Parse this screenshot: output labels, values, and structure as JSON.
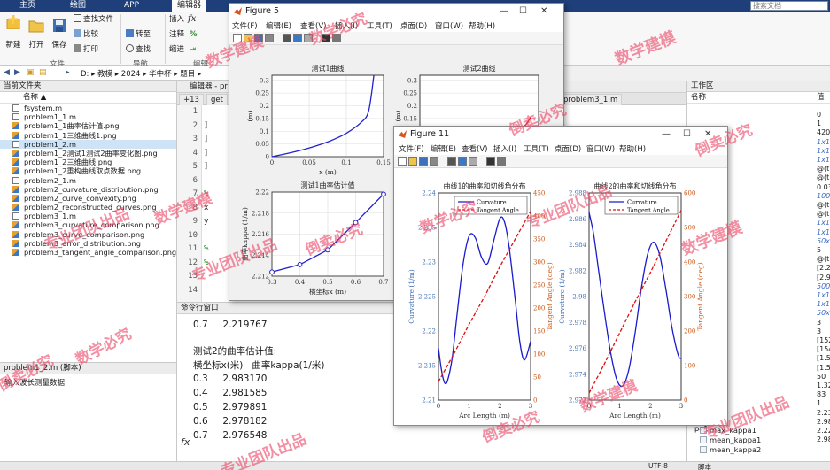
{
  "ribbon": {
    "tabs": [
      "主页",
      "绘图",
      "APP",
      "编辑器"
    ],
    "search_placeholder": "搜索文档",
    "buttons": {
      "new": "新建",
      "open": "打开",
      "save": "保存",
      "find_files": "查找文件",
      "compare": "比较",
      "print": "打印",
      "go_to": "转至",
      "find": "查找",
      "insert": "插入",
      "comment": "注释",
      "indent": "缩进"
    },
    "groups": {
      "file": "文件",
      "navigate": "导航",
      "edit": "编辑"
    }
  },
  "address": {
    "path": [
      "D:",
      "教模",
      "2024",
      "华中杯",
      "题目"
    ]
  },
  "current_folder": {
    "title": "当前文件夹",
    "column": "名称",
    "sort_indicator": "▲",
    "files": [
      {
        "name": "fsystem.m",
        "type": "m"
      },
      {
        "name": "problem1_1.m",
        "type": "m"
      },
      {
        "name": "problem1_1曲率估计值.png",
        "type": "png"
      },
      {
        "name": "problem1_1三维曲线1.png",
        "type": "png"
      },
      {
        "name": "problem1_2.m",
        "type": "m",
        "selected": true
      },
      {
        "name": "problem1_2测试1测试2曲率变化图.png",
        "type": "png"
      },
      {
        "name": "problem1_2三维曲线.png",
        "type": "png"
      },
      {
        "name": "problem1_2重构曲线取点数据.png",
        "type": "png"
      },
      {
        "name": "problem2_1.m",
        "type": "m"
      },
      {
        "name": "problem2_curvature_distribution.png",
        "type": "png"
      },
      {
        "name": "problem2_curve_convexity.png",
        "type": "png"
      },
      {
        "name": "problem2_reconstructed_curves.png",
        "type": "png"
      },
      {
        "name": "problem3_1.m",
        "type": "m"
      },
      {
        "name": "problem3_curvature_comparison.png",
        "type": "png"
      },
      {
        "name": "problem3_curve_comparison.png",
        "type": "png"
      },
      {
        "name": "problem3_error_distribution.png",
        "type": "png"
      },
      {
        "name": "problem3_tangent_angle_comparison.png",
        "type": "png"
      }
    ]
  },
  "details": {
    "title": "problem1_2.m (脚本)",
    "description": "输入波长测量数据"
  },
  "editor": {
    "title": "编辑器 - pr",
    "tabs": [
      "+13",
      "get",
      "problem3_1.m"
    ],
    "line_numbers": [
      "1",
      "2",
      "3",
      "4",
      "5",
      "6",
      "7",
      "8",
      "9",
      "10",
      "11",
      "12",
      "13",
      "14"
    ],
    "fragments": [
      "]",
      "]",
      "]",
      "]",
      "%",
      "x",
      "y",
      "%",
      "%"
    ]
  },
  "command_window": {
    "title": "命令行窗口",
    "prev_line": {
      "x": "0.7",
      "k": "2.219767"
    },
    "heading": "测试2的曲率估计值:",
    "columns": "横坐标x(米)   曲率kappa(1/米)",
    "rows": [
      {
        "x": "0.3",
        "k": "2.983170"
      },
      {
        "x": "0.4",
        "k": "2.981585"
      },
      {
        "x": "0.5",
        "k": "2.979891"
      },
      {
        "x": "0.6",
        "k": "2.978182"
      },
      {
        "x": "0.7",
        "k": "2.976548"
      }
    ],
    "prompt": "fx"
  },
  "workspace": {
    "title": "工作区",
    "col_name": "名称",
    "col_value": "值",
    "values": [
      {
        "text": "0"
      },
      {
        "text": "1"
      },
      {
        "text": "4200"
      },
      {
        "text": "1x1",
        "italic": true
      },
      {
        "text": "1x1",
        "italic": true
      },
      {
        "text": "1x1",
        "italic": true
      },
      {
        "text": "@(t)"
      },
      {
        "text": "@(t)"
      },
      {
        "text": "0.03"
      },
      {
        "text": "100x",
        "italic": true
      },
      {
        "text": "@(t)"
      },
      {
        "text": "@(t)"
      },
      {
        "text": "1x10",
        "italic": true
      },
      {
        "text": "1x1",
        "italic": true
      },
      {
        "text": "50x",
        "italic": true
      },
      {
        "text": "5"
      },
      {
        "text": "@(t)"
      },
      {
        "text": "[2.2"
      },
      {
        "text": "[2.98"
      },
      {
        "text": "500x",
        "italic": true
      },
      {
        "text": "1x1c",
        "italic": true
      },
      {
        "text": "1x10",
        "italic": true
      },
      {
        "text": "50x",
        "italic": true
      },
      {
        "text": "3"
      },
      {
        "text": "3"
      },
      {
        "text": "[152"
      },
      {
        "text": "[154"
      },
      {
        "text": "[1.52"
      },
      {
        "text": "[1.54"
      },
      {
        "text": "50"
      },
      {
        "text": "1.32"
      },
      {
        "text": "83"
      },
      {
        "text": "1"
      },
      {
        "text": "2.23"
      },
      {
        "text": "2.98"
      },
      {
        "text": "2.22"
      },
      {
        "text": "2.98"
      }
    ],
    "visible_names": [
      "max_kappa1",
      "mean_kappa1",
      "mean_kappa2"
    ],
    "partial_names": [
      "x2",
      "pa2",
      "pa1"
    ]
  },
  "status": {
    "encoding": "UTF-8",
    "script": "脚本"
  },
  "figure5": {
    "title": "Figure 5",
    "menu": [
      "文件(F)",
      "编辑(E)",
      "查看(V)",
      "插入(I)",
      "工具(T)",
      "桌面(D)",
      "窗口(W)",
      "帮助(H)"
    ],
    "toolbar_icons": [
      "new-icon",
      "open-icon",
      "save-icon",
      "print-icon",
      "link-icon",
      "colorbar-icon",
      "legend-icon",
      "pointer-icon",
      "property-icon"
    ]
  },
  "figure11": {
    "title": "Figure 11",
    "menu": [
      "文件(F)",
      "编辑(E)",
      "查看(V)",
      "插入(I)",
      "工具(T)",
      "桌面(D)",
      "窗口(W)",
      "帮助(H)"
    ],
    "toolbar_icons": [
      "new-icon",
      "open-icon",
      "save-icon",
      "print-icon",
      "link-icon",
      "colorbar-icon",
      "legend-icon",
      "pointer-icon",
      "property-icon"
    ]
  },
  "watermark": {
    "phrases": [
      "数学建模",
      "专业团队出品",
      "数学必究",
      "倒卖必究"
    ]
  },
  "chart_data": [
    {
      "id": "fig5_curve1",
      "type": "line",
      "title": "测试1曲线",
      "xlabel": "x (m)",
      "ylabel": "(m)",
      "xlim": [
        0,
        0.15
      ],
      "ylim": [
        0,
        0.32
      ],
      "xticks": [
        0,
        0.05,
        0.1,
        0.15
      ],
      "xtick_labels": [
        "0",
        "0.05",
        "0.1",
        "0.15"
      ],
      "yticks": [
        0,
        0.05,
        0.1,
        0.15,
        0.2,
        0.25,
        0.3
      ],
      "ytick_labels": [
        "0",
        "0.05",
        "0.1",
        "0.15",
        "0.2",
        "0.25",
        "0.3"
      ],
      "grid": true,
      "color": "#2222cc",
      "x": [
        0,
        0.02,
        0.04,
        0.06,
        0.08,
        0.1,
        0.12,
        0.13,
        0.137
      ],
      "y": [
        0,
        0.012,
        0.026,
        0.043,
        0.064,
        0.092,
        0.135,
        0.18,
        0.32
      ]
    },
    {
      "id": "fig5_curve2",
      "type": "line",
      "title": "测试2曲线",
      "ylabel": "(m)",
      "xlim": [
        0,
        0.15
      ],
      "ylim": [
        0,
        0.32
      ],
      "yticks": [
        0,
        0.05,
        0.1,
        0.15,
        0.2,
        0.25,
        0.3
      ],
      "ytick_labels": [
        "0",
        "0.05",
        "0.1",
        "0.15",
        "0.2",
        "0.25",
        "0.3"
      ],
      "grid": true,
      "color": "#dd1111",
      "x": [
        0,
        0.03,
        0.06,
        0.09,
        0.11,
        0.125,
        0.135,
        0.14
      ],
      "y": [
        0,
        0.01,
        0.025,
        0.048,
        0.072,
        0.1,
        0.13,
        0.155
      ]
    },
    {
      "id": "fig5_kappa1",
      "type": "line",
      "title": "测试1曲率估计值",
      "xlabel": "横坐标x (m)",
      "ylabel": "曲率kappa (1/m)",
      "xlim": [
        0.3,
        0.7
      ],
      "ylim": [
        2.212,
        2.22
      ],
      "xticks": [
        0.3,
        0.4,
        0.5,
        0.6,
        0.7
      ],
      "xtick_labels": [
        "0.3",
        "0.4",
        "0.5",
        "0.6",
        "0.7"
      ],
      "yticks": [
        2.212,
        2.214,
        2.216,
        2.218,
        2.22
      ],
      "ytick_labels": [
        "2.212",
        "2.214",
        "2.216",
        "2.218",
        "2.22"
      ],
      "grid": true,
      "color": "#2222cc",
      "x": [
        0.3,
        0.4,
        0.5,
        0.6,
        0.7
      ],
      "y": [
        2.2124,
        2.2131,
        2.2145,
        2.2171,
        2.2198
      ]
    },
    {
      "id": "fig11_curve1",
      "type": "line",
      "title": "曲线1的曲率和切线角分布",
      "xlabel": "Arc Length (m)",
      "ylabel": "Curvature (1/m)",
      "ylabel_right": "Tangent Angle (deg)",
      "xlim": [
        0,
        3
      ],
      "ylim": [
        2.21,
        2.24
      ],
      "ylim_right": [
        0,
        450
      ],
      "xticks": [
        0,
        1,
        2,
        3
      ],
      "xtick_labels": [
        "0",
        "1",
        "2",
        "3"
      ],
      "yticks": [
        2.21,
        2.215,
        2.22,
        2.225,
        2.23,
        2.235,
        2.24
      ],
      "ytick_labels": [
        "2.21",
        "2.215",
        "2.22",
        "2.225",
        "2.23",
        "2.235",
        "2.24"
      ],
      "yticks_right": [
        0,
        50,
        100,
        150,
        200,
        250,
        300,
        350,
        400,
        450
      ],
      "ytick_labels_right": [
        "0",
        "50",
        "100",
        "150",
        "200",
        "250",
        "300",
        "350",
        "400",
        "450"
      ],
      "legend": [
        "Curvature",
        "Tangent Angle"
      ],
      "legend_position": "top",
      "series": [
        {
          "name": "Curvature",
          "style": "solid",
          "color": "#1a1acc",
          "x": [
            0,
            0.1,
            0.2,
            0.3,
            0.45,
            0.6,
            0.8,
            1.0,
            1.2,
            1.4,
            1.6,
            1.8,
            2.0,
            2.15,
            2.3,
            2.5,
            2.65,
            2.8,
            3.0
          ],
          "y": [
            2.2175,
            2.2143,
            2.2125,
            2.2129,
            2.2162,
            2.2222,
            2.2297,
            2.2338,
            2.2335,
            2.2307,
            2.2298,
            2.2331,
            2.2363,
            2.2358,
            2.2322,
            2.2245,
            2.2184,
            2.2158,
            2.2185
          ]
        },
        {
          "name": "Tangent Angle",
          "style": "dashed",
          "color": "#dd1111",
          "axis": "right",
          "x": [
            0,
            0.5,
            1.0,
            1.5,
            2.0,
            2.5,
            3.0
          ],
          "y": [
            40,
            100,
            165,
            225,
            290,
            350,
            410
          ]
        }
      ]
    },
    {
      "id": "fig11_curve2",
      "type": "line",
      "title": "曲线2的曲率和切线角分布",
      "xlabel": "Arc Length (m)",
      "ylabel": "Curvature (1/m)",
      "ylabel_right": "Tangent Angle (deg)",
      "xlim": [
        0,
        3
      ],
      "ylim": [
        2.972,
        2.988
      ],
      "ylim_right": [
        0,
        600
      ],
      "xticks": [
        0,
        1,
        2,
        3
      ],
      "xtick_labels": [
        "0",
        "1",
        "2",
        "3"
      ],
      "yticks": [
        2.972,
        2.974,
        2.976,
        2.978,
        2.98,
        2.982,
        2.984,
        2.986,
        2.988
      ],
      "ytick_labels": [
        "2.972",
        "2.974",
        "2.976",
        "2.978",
        "2.98",
        "2.982",
        "2.984",
        "2.986",
        "2.988"
      ],
      "yticks_right": [
        0,
        100,
        200,
        300,
        400,
        500,
        600
      ],
      "ytick_labels_right": [
        "0",
        "100",
        "200",
        "300",
        "400",
        "500",
        "600"
      ],
      "legend": [
        "Curvature",
        "Tangent Angle"
      ],
      "legend_position": "top",
      "series": [
        {
          "name": "Curvature",
          "style": "solid",
          "color": "#1a1acc",
          "x": [
            0,
            0.15,
            0.3,
            0.5,
            0.7,
            0.9,
            1.1,
            1.3,
            1.5,
            1.7,
            1.9,
            2.1,
            2.3,
            2.5,
            2.7,
            2.9,
            3.0
          ],
          "y": [
            2.9865,
            2.9848,
            2.9822,
            2.9788,
            2.9757,
            2.9736,
            2.9731,
            2.9744,
            2.9772,
            2.9806,
            2.9832,
            2.9842,
            2.9832,
            2.9806,
            2.9776,
            2.9755,
            2.9752
          ]
        },
        {
          "name": "Tangent Angle",
          "style": "dashed",
          "color": "#dd1111",
          "axis": "right",
          "x": [
            0,
            0.5,
            1.0,
            1.5,
            2.0,
            2.5,
            3.0
          ],
          "y": [
            20,
            105,
            195,
            285,
            370,
            460,
            550
          ]
        }
      ]
    }
  ]
}
